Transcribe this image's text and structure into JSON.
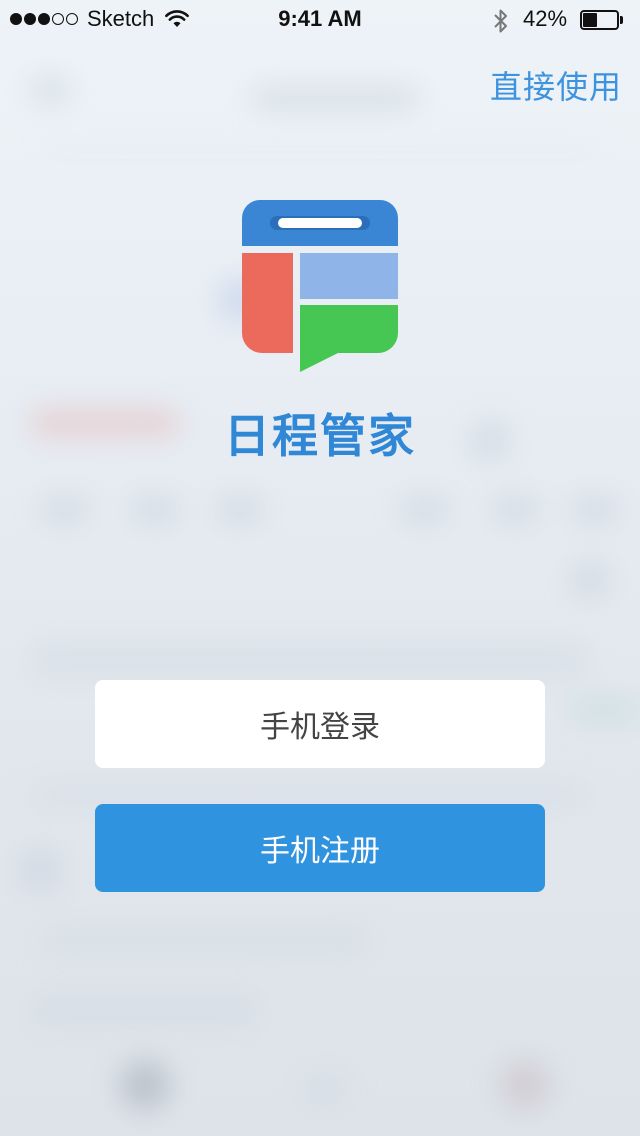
{
  "status_bar": {
    "carrier": "Sketch",
    "signal_bars_filled": 3,
    "signal_bars_total": 5,
    "time": "9:41 AM",
    "battery_percent_label": "42%",
    "battery_level": 0.42,
    "icons": [
      "signal-icon",
      "wifi-icon",
      "bluetooth-icon",
      "battery-icon"
    ]
  },
  "header": {
    "skip_label": "直接使用"
  },
  "app": {
    "name": "日程管家",
    "logo_icon": "calendar-chat-logo"
  },
  "actions": {
    "login_label": "手机登录",
    "register_label": "手机注册"
  },
  "colors": {
    "accent": "#3093df",
    "brand_text": "#2f87d6",
    "link": "#3d93de",
    "logo_top": "#3b86d4",
    "logo_red": "#ec6a5c",
    "logo_lightblue": "#8fb4e8",
    "logo_green": "#46c653"
  }
}
